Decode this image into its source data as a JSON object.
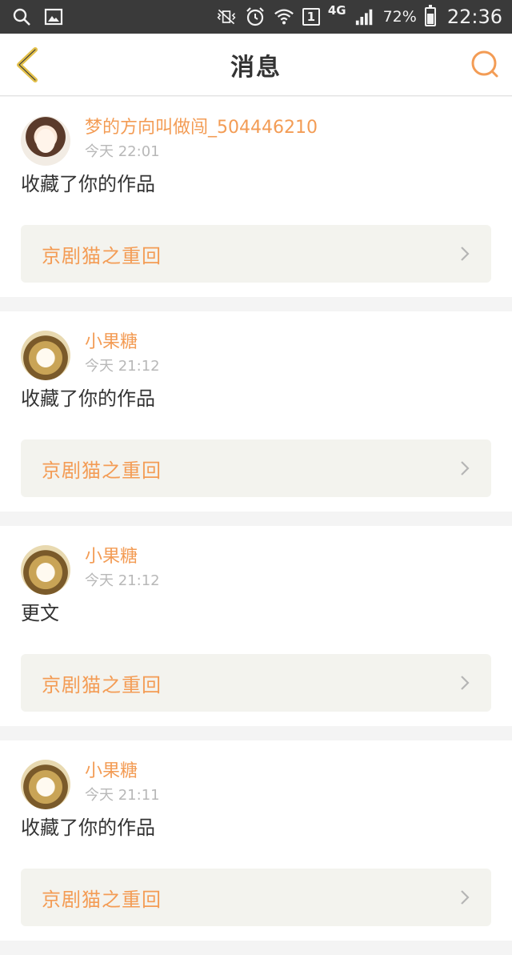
{
  "status_bar": {
    "sim_slot": "1",
    "network": "4G",
    "battery_percent": "72%",
    "time": "22:36"
  },
  "header": {
    "title": "消息"
  },
  "notifications": [
    {
      "username": "梦的方向叫做闯_504446210",
      "time": "今天 22:01",
      "action": "收藏了你的作品",
      "work_title": "京剧猫之重回"
    },
    {
      "username": "小果糖",
      "time": "今天 21:12",
      "action": "收藏了你的作品",
      "work_title": "京剧猫之重回"
    },
    {
      "username": "小果糖",
      "time": "今天 21:12",
      "action": "更文",
      "work_title": "京剧猫之重回"
    },
    {
      "username": "小果糖",
      "time": "今天 21:11",
      "action": "收藏了你的作品",
      "work_title": "京剧猫之重回"
    }
  ],
  "colors": {
    "accent": "#f39c55",
    "back_icon": "#e3c04a",
    "status_bar_bg": "#3a3a3a"
  },
  "icons": {
    "back": "chevron-left-icon",
    "search": "search-icon",
    "item_arrow": "chevron-right-icon"
  }
}
